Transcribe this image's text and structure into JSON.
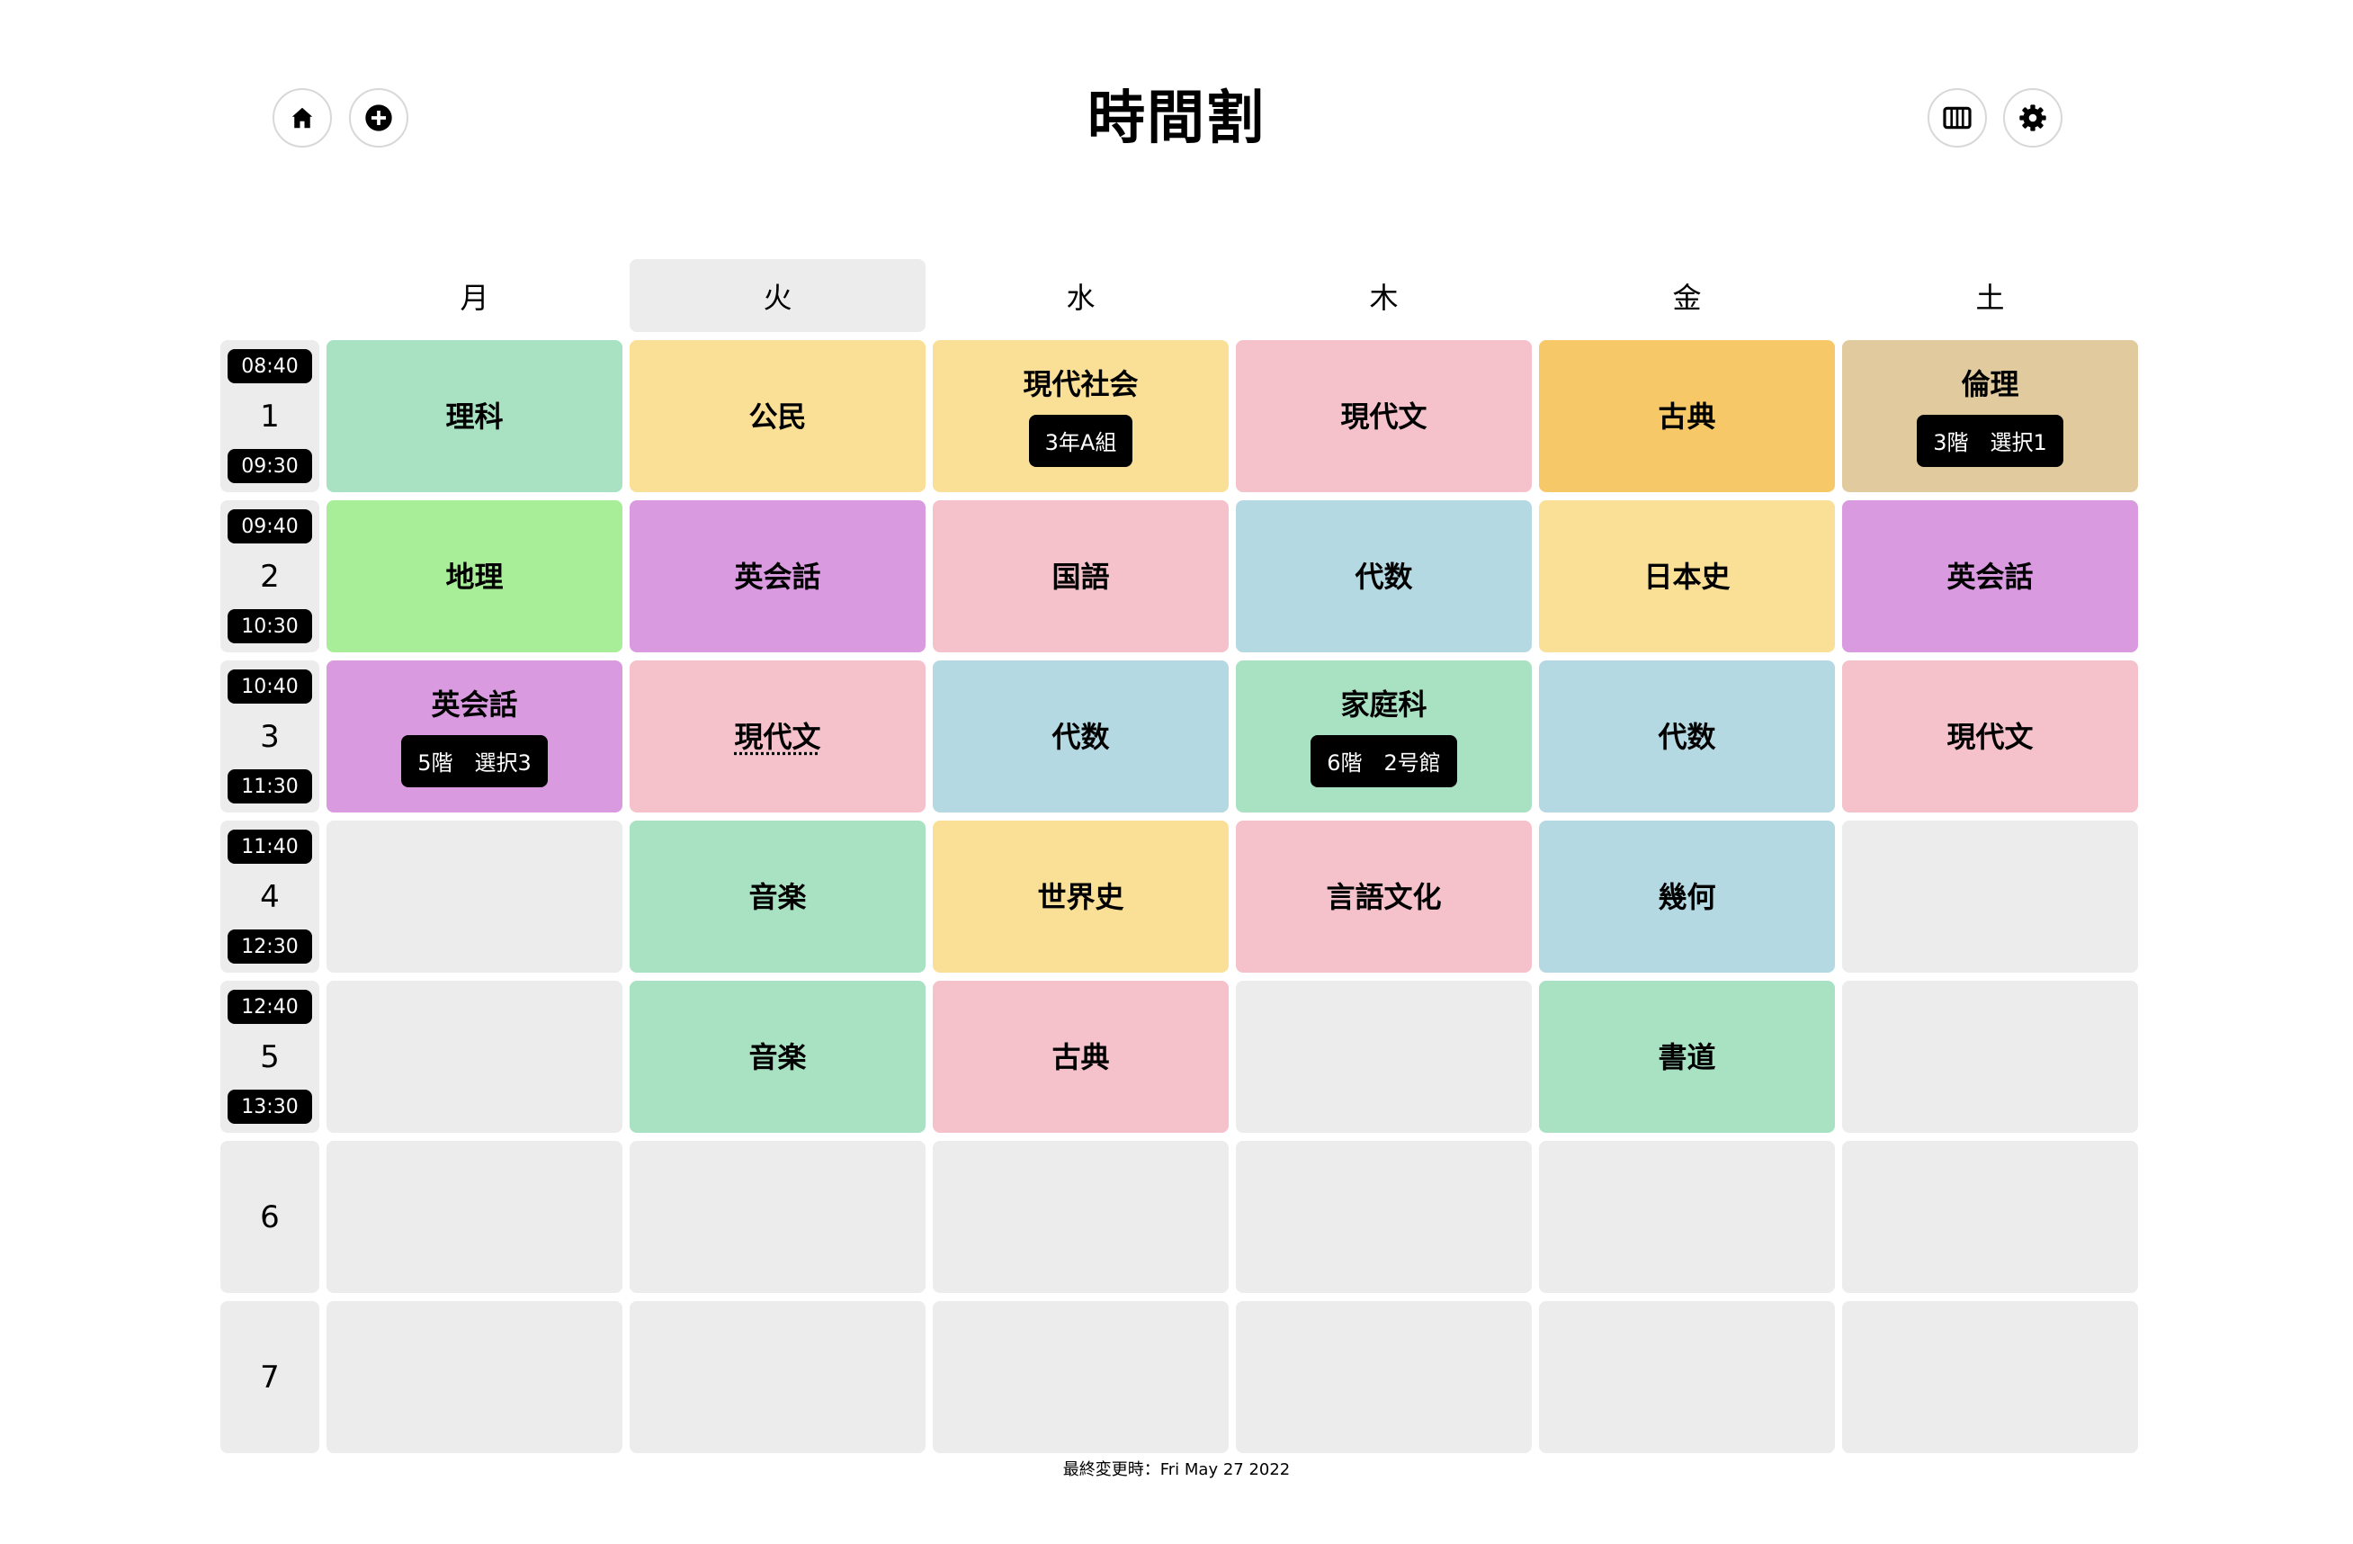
{
  "title": "時間割",
  "header": {
    "home_icon": "home-icon",
    "add_icon": "plus-circle-icon",
    "columns_icon": "columns-icon",
    "settings_icon": "gear-icon"
  },
  "colors": {
    "green": "#a9e2c3",
    "lightgreen": "#a8ed98",
    "yellow": "#fae096",
    "orange": "#f7c867",
    "pink": "#f5c2cc",
    "purple": "#d99ae0",
    "blue": "#b5d9e3",
    "tan": "#e1cb9e",
    "empty": "#ececec"
  },
  "days": [
    "月",
    "火",
    "水",
    "木",
    "金",
    "土"
  ],
  "today_index": 1,
  "periods": [
    {
      "num": "1",
      "start": "08:40",
      "end": "09:30"
    },
    {
      "num": "2",
      "start": "09:40",
      "end": "10:30"
    },
    {
      "num": "3",
      "start": "10:40",
      "end": "11:30"
    },
    {
      "num": "4",
      "start": "11:40",
      "end": "12:30"
    },
    {
      "num": "5",
      "start": "12:40",
      "end": "13:30"
    },
    {
      "num": "6",
      "start": "",
      "end": ""
    },
    {
      "num": "7",
      "start": "",
      "end": ""
    }
  ],
  "timetable": [
    [
      {
        "subject": "理科",
        "color": "green"
      },
      {
        "subject": "公民",
        "color": "yellow"
      },
      {
        "subject": "現代社会",
        "room": "3年A組",
        "color": "yellow"
      },
      {
        "subject": "現代文",
        "color": "pink"
      },
      {
        "subject": "古典",
        "color": "orange"
      },
      {
        "subject": "倫理",
        "room": "3階　選択1",
        "color": "tan"
      }
    ],
    [
      {
        "subject": "地理",
        "color": "lightgreen"
      },
      {
        "subject": "英会話",
        "color": "purple"
      },
      {
        "subject": "国語",
        "color": "pink"
      },
      {
        "subject": "代数",
        "color": "blue"
      },
      {
        "subject": "日本史",
        "color": "yellow"
      },
      {
        "subject": "英会話",
        "color": "purple"
      }
    ],
    [
      {
        "subject": "英会話",
        "room": "5階　選択3",
        "color": "purple"
      },
      {
        "subject": "現代文",
        "color": "pink",
        "dotted": true
      },
      {
        "subject": "代数",
        "color": "blue"
      },
      {
        "subject": "家庭科",
        "room": "6階　2号館",
        "color": "green"
      },
      {
        "subject": "代数",
        "color": "blue"
      },
      {
        "subject": "現代文",
        "color": "pink"
      }
    ],
    [
      null,
      {
        "subject": "音楽",
        "color": "green"
      },
      {
        "subject": "世界史",
        "color": "yellow"
      },
      {
        "subject": "言語文化",
        "color": "pink"
      },
      {
        "subject": "幾何",
        "color": "blue"
      },
      null
    ],
    [
      null,
      {
        "subject": "音楽",
        "color": "green"
      },
      {
        "subject": "古典",
        "color": "pink"
      },
      null,
      {
        "subject": "書道",
        "color": "green"
      },
      null
    ],
    [
      null,
      null,
      null,
      null,
      null,
      null
    ],
    [
      null,
      null,
      null,
      null,
      null,
      null
    ]
  ],
  "footer": "最終変更時：Fri May 27 2022"
}
